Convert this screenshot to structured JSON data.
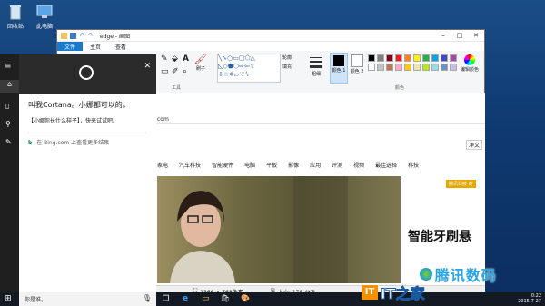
{
  "desktop": {
    "icons": [
      {
        "label": "回收站",
        "icon": "recycle-bin-icon"
      },
      {
        "label": "此电脑",
        "icon": "computer-icon"
      }
    ]
  },
  "paint": {
    "title": "edge - 画图",
    "tabs": [
      "文件",
      "主页",
      "查看"
    ],
    "ribbon": {
      "groups": [
        "工具",
        "刷子",
        "形状",
        "轮廓",
        "填充",
        "粗细",
        "颜色 1",
        "颜色 2",
        "颜色",
        "编辑颜色"
      ]
    },
    "status": {
      "dimensions": "1366 × 768像素",
      "size": "大小: 178.4KB"
    },
    "palette": [
      "#000000",
      "#7f7f7f",
      "#880015",
      "#ed1c24",
      "#ff7f27",
      "#fff200",
      "#22b14c",
      "#00a2e8",
      "#3f48cc",
      "#a349a4",
      "#ffffff",
      "#c3c3c3",
      "#b97a57",
      "#ffaec9",
      "#ffc90e",
      "#efe4b0",
      "#b5e61d",
      "#99d9ea",
      "#7092be",
      "#c8bfe7"
    ]
  },
  "webpage": {
    "url_fragment": "com",
    "right_button": "净文",
    "nav": [
      "家电",
      "汽车科技",
      "智能硬件",
      "电脑",
      "平板",
      "影像",
      "应用",
      "评测",
      "视频",
      "最佳选择",
      "科技"
    ],
    "ad_tag": "腾讯科技·商",
    "headline": "智能牙刷悬"
  },
  "cortana": {
    "greeting": "叫我Cortana。小娜都可以的。",
    "tip": "【小娜你长什么样子】，快来试试吧。",
    "bing": "在 Bing.com 上查看更多结果",
    "search_placeholder": "你是谁。"
  },
  "taskbar": {
    "time": "0:22",
    "date": "2015-7-27"
  },
  "watermarks": {
    "site1": "腾讯数码",
    "site2": "IT之家",
    "site2_text": "IT之家"
  },
  "colors": {
    "accent": "#1979ca",
    "taskbar": "#141a24",
    "cortana_dark": "#2b2b2b"
  }
}
